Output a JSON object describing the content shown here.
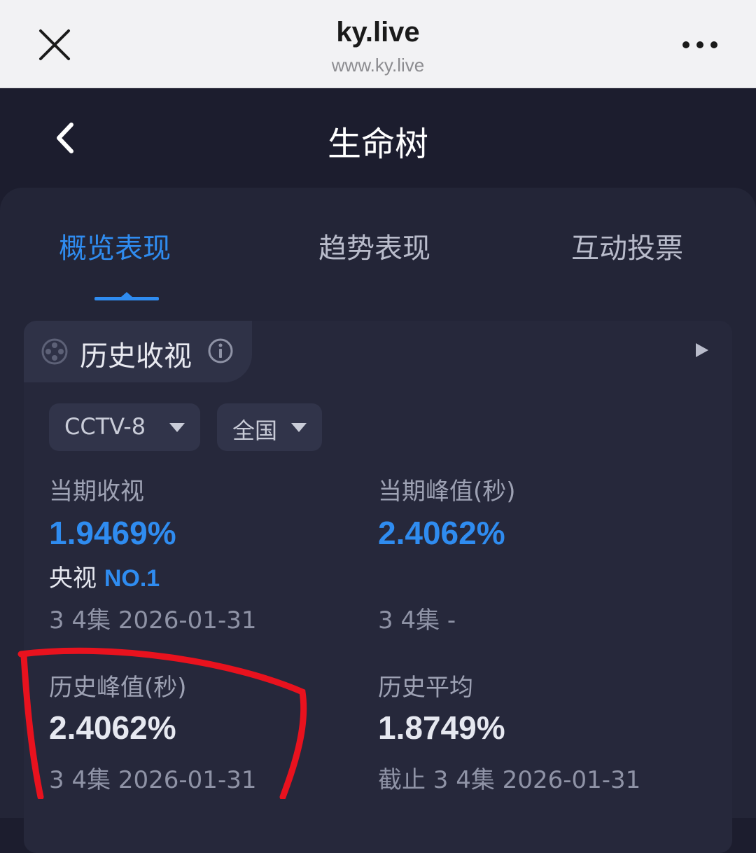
{
  "browser": {
    "title": "ky.live",
    "url": "www.ky.live",
    "close_icon": "close-icon",
    "more_icon": "more-icon"
  },
  "header": {
    "back_icon": "chevron-left-icon",
    "title": "生命树"
  },
  "tabs": [
    {
      "label": "概览表现",
      "active": true
    },
    {
      "label": "趋势表现",
      "active": false
    },
    {
      "label": "互动投票",
      "active": false
    }
  ],
  "card": {
    "title": "历史收视",
    "icon": "film-reel-icon",
    "info_icon": "info-icon",
    "expand_icon": "play-icon",
    "filters": {
      "channel": "CCTV-8",
      "region": "全国"
    },
    "stats": {
      "current_rating": {
        "label": "当期收视",
        "value": "1.9469%",
        "rank_prefix": "央视",
        "rank": "NO.1",
        "meta": "3 4集 2026-01-31"
      },
      "current_peak": {
        "label": "当期峰值(秒)",
        "value": "2.4062%",
        "meta": "3 4集 -"
      },
      "history_peak": {
        "label": "历史峰值(秒)",
        "value": "2.4062%",
        "meta": "3 4集 2026-01-31"
      },
      "history_average": {
        "label": "历史平均",
        "value": "1.8749%",
        "meta": "截止 3 4集 2026-01-31"
      }
    }
  },
  "colors": {
    "accent": "#2f8cf0",
    "background": "#1c1d2e",
    "annotation": "#e8121e"
  }
}
